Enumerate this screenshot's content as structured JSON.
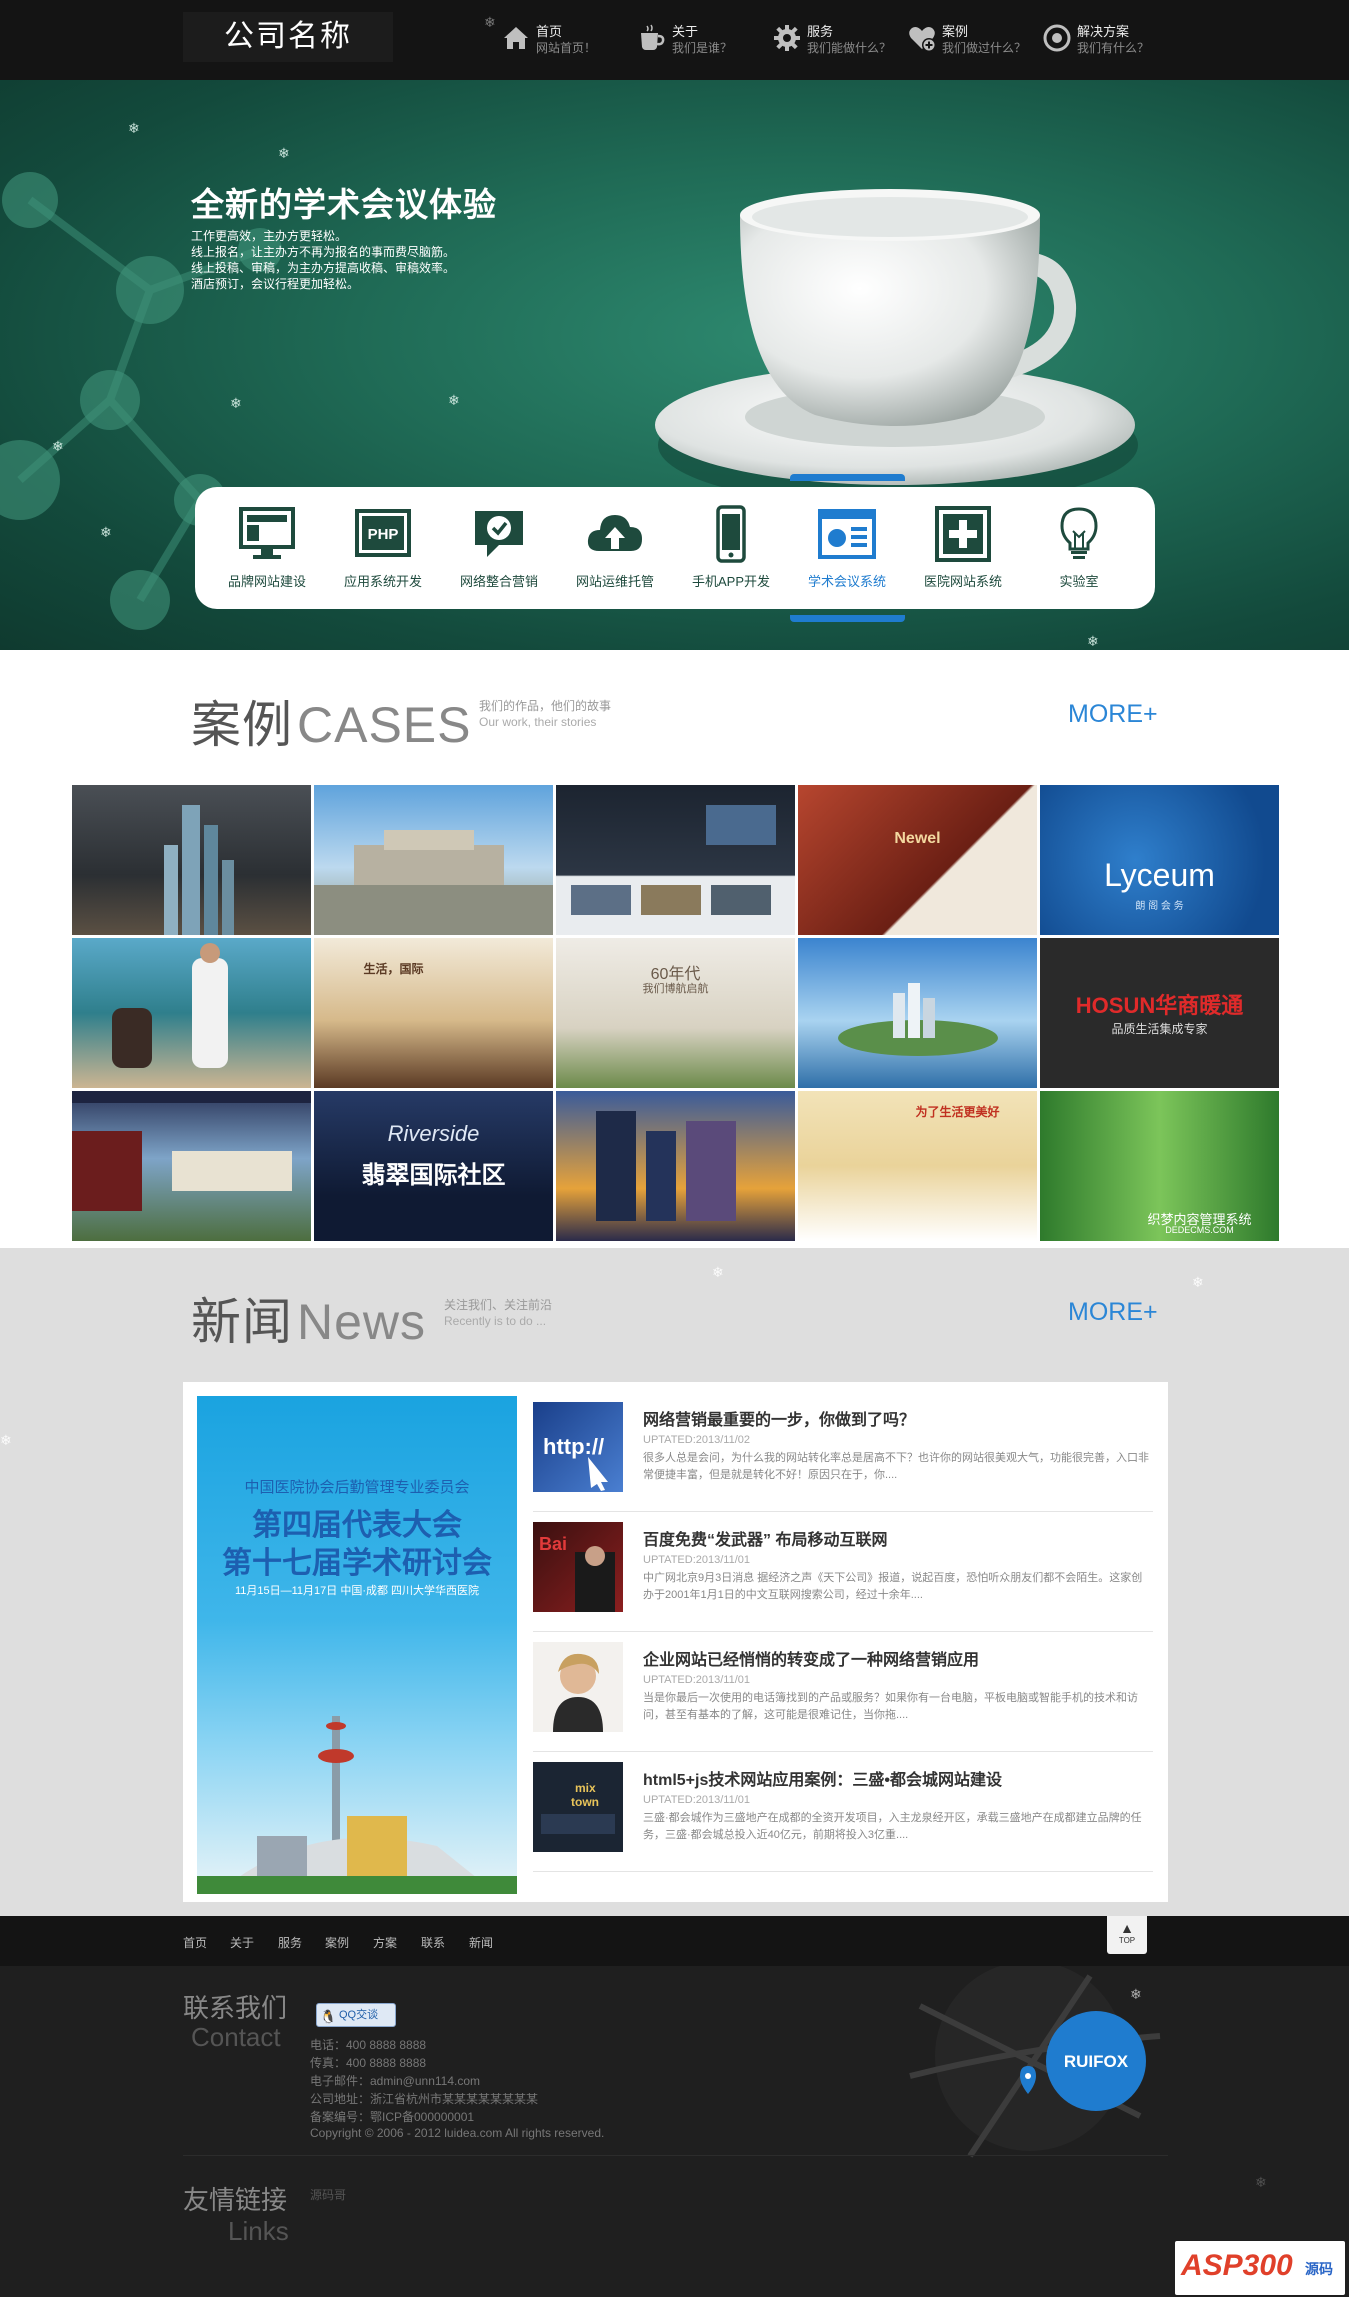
{
  "brand": {
    "logo_text": "公司名称"
  },
  "nav": [
    {
      "title": "首页",
      "sub": "网站首页！",
      "icon": "home-icon"
    },
    {
      "title": "关于",
      "sub": "我们是谁？",
      "icon": "coffee-cup-icon"
    },
    {
      "title": "服务",
      "sub": "我们能做什么？",
      "icon": "gear-icon"
    },
    {
      "title": "案例",
      "sub": "我们做过什么？",
      "icon": "heart-plus-icon"
    },
    {
      "title": "解决方案",
      "sub": "我们有什么？",
      "icon": "disc-icon"
    }
  ],
  "hero": {
    "title": "全新的学术会议体验",
    "lines": [
      "工作更高效，主办方更轻松。",
      "线上报名，让主办方不再为报名的事而费尽脑筋。",
      "线上投稿、审稿，为主办方提高收稿、审稿效率。",
      "酒店预订，会议行程更加轻松。"
    ]
  },
  "services": [
    {
      "label": "品牌网站建设",
      "icon": "monitor-icon"
    },
    {
      "label": "应用系统开发",
      "icon": "php-icon"
    },
    {
      "label": "网络整合营销",
      "icon": "chat-check-icon"
    },
    {
      "label": "网站运维托管",
      "icon": "cloud-upload-icon"
    },
    {
      "label": "手机APP开发",
      "icon": "mobile-phone-icon"
    },
    {
      "label": "学术会议系统",
      "icon": "presentation-icon",
      "active": true
    },
    {
      "label": "医院网站系统",
      "icon": "medical-cross-icon"
    },
    {
      "label": "实验室",
      "icon": "light-bulb-icon"
    }
  ],
  "cases": {
    "title_cn": "案例",
    "title_en": "CASES",
    "sub_cn": "我们的作品，他们的故事",
    "sub_en": "Our work, their stories",
    "more": "MORE+",
    "tiles": [
      {
        "caption": "",
        "bg": "#3a3f46"
      },
      {
        "caption": "",
        "bg": "#6ea8d6"
      },
      {
        "caption": "",
        "bg": "#222a33"
      },
      {
        "caption": "Newel",
        "bg": "#8a2c22"
      },
      {
        "caption": "Lyceum",
        "sub": "朗 阁 会 务",
        "bg": "#1b5fa8"
      },
      {
        "caption": "",
        "bg": "#2e8ea8"
      },
      {
        "caption": "生活，国际",
        "bg": "#c29b63"
      },
      {
        "caption": "60年代",
        "sub": "我们博航启航",
        "bg": "#d9d3c3"
      },
      {
        "caption": "",
        "bg": "#4d8fd1"
      },
      {
        "caption": "HOSUN华商暖通",
        "sub": "品质生活集成专家",
        "bg": "#2a2a2a"
      },
      {
        "caption": "",
        "bg": "#2d3f66"
      },
      {
        "caption": "Riverside",
        "sub": "翡翠国际社区",
        "bg": "#1b2a4a"
      },
      {
        "caption": "",
        "bg": "#3a4f7a"
      },
      {
        "caption": "为了生活更美好",
        "bg": "#e6cfa0"
      },
      {
        "caption": "织梦内容管理系统",
        "sub": "DEDECMS.COM",
        "bg": "#3b8a3a"
      }
    ]
  },
  "news": {
    "title_cn": "新闻",
    "title_en": "News",
    "sub_cn": "关注我们、关注前沿",
    "sub_en": "Recently is to do ...",
    "more": "MORE+",
    "poster": {
      "line1": "中国医院协会后勤管理专业委员会",
      "line2": "第四届代表大会",
      "line3": "第十七届学术研讨会",
      "line4": "11月15日—11月17日 中国·成都  四川大学华西医院"
    },
    "items": [
      {
        "title": "网络营销最重要的一步，你做到了吗？",
        "date": "UPTATED:2013/11/02",
        "desc": "很多人总是会问，为什么我的网站转化率总是居高不下？也许你的网站很美观大气，功能很完善，入口非常便捷丰富，但是就是转化不好！原因只在于，你....",
        "thumb": "http-icon"
      },
      {
        "title": "百度免费“发武器” 布局移动互联网",
        "date": "UPTATED:2013/11/01",
        "desc": "中广网北京9月3日消息 据经济之声《天下公司》报道，说起百度，恐怕听众朋友们都不会陌生。这家创办于2001年1月1日的中文互联网搜索公司，经过十余年....",
        "thumb": "baidu-icon"
      },
      {
        "title": "企业网站已经悄悄的转变成了一种网络营销应用",
        "date": "UPTATED:2013/11/01",
        "desc": "当是你最后一次使用的电话簿找到的产品或服务？如果你有一台电脑，平板电脑或智能手机的技术和访问，甚至有基本的了解，这可能是很难记住，当你拖....",
        "thumb": "person-icon"
      },
      {
        "title": "html5+js技术网站应用案例：三盛•都会城网站建设",
        "date": "UPTATED:2013/11/01",
        "desc": "三盛·都会城作为三盛地产在成都的全资开发项目，入主龙泉经开区，承载三盛地产在成都建立品牌的任务，三盛·都会城总投入近40亿元，前期将投入3亿重....",
        "thumb": "mix-town-icon"
      }
    ]
  },
  "footer_nav": [
    "首页",
    "关于",
    "服务",
    "案例",
    "方案",
    "联系",
    "新闻"
  ],
  "top_button": "TOP",
  "contact": {
    "title_cn": "联系我们",
    "title_en": "Contact",
    "qq": "QQ交谈",
    "lines": [
      "电话：400 8888 8888",
      "传真：400 8888 8888",
      "电子邮件：admin@unn114.com",
      "公司地址：浙江省杭州市某某某某某某某某",
      "备案编号：鄂ICP备000000001",
      "Copyright © 2006 - 2012 luidea.com All rights reserved."
    ],
    "map_badge": "RUIFOX"
  },
  "links": {
    "title_cn": "友情链接",
    "title_en": "Links",
    "items": [
      "源码哥"
    ]
  },
  "watermark": {
    "text": "ASP300",
    "sub": "源码"
  },
  "colors": {
    "accent": "#2b86d6",
    "hero_green": "#1f6a55",
    "dark_bar": "#141414",
    "news_bg": "#dedede"
  }
}
